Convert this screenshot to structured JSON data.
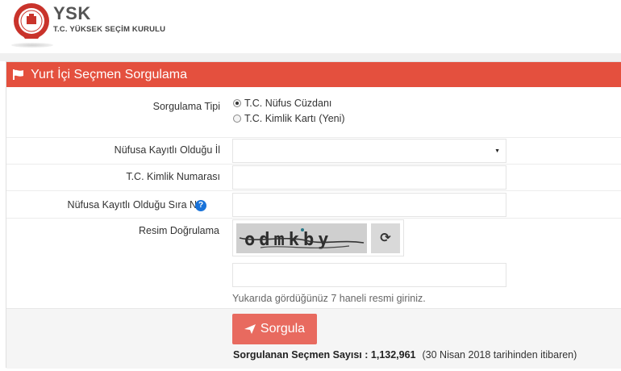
{
  "header": {
    "logo_text": "YSK",
    "logo_subtitle": "T.C. YÜKSEK SEÇİM KURULU"
  },
  "panel": {
    "title": "Yurt İçi Seçmen Sorgulama"
  },
  "form": {
    "query_type_label": "Sorgulama Tipi",
    "query_type_options": [
      "T.C. Nüfus Cüzdanı",
      "T.C. Kimlik Kartı (Yeni)"
    ],
    "query_type_selected": 0,
    "province_label": "Nüfusa Kayıtlı Olduğu İl",
    "province_value": "",
    "tc_label": "T.C. Kimlik Numarası",
    "tc_value": "",
    "sira_label": "Nüfusa Kayıtlı Olduğu Sıra No",
    "captcha_label": "Resim Doğrulama",
    "captcha_text": "odmkby",
    "captcha_value": "",
    "captcha_hint": "Yukarıda gördüğünüz 7 haneli resmi giriniz."
  },
  "submit": {
    "label": "Sorgula"
  },
  "stats": {
    "count_label": "Sorgulanan Seçmen Sayısı : 1,132,961",
    "note": "(30 Nisan 2018 tarihinden itibaren)"
  },
  "colors": {
    "header_red": "#e4503e",
    "button_red": "#e86a5f",
    "help_blue": "#1a73d9"
  },
  "icons": [
    "seal-icon",
    "flag-icon",
    "help-icon",
    "refresh-icon",
    "send-icon"
  ]
}
